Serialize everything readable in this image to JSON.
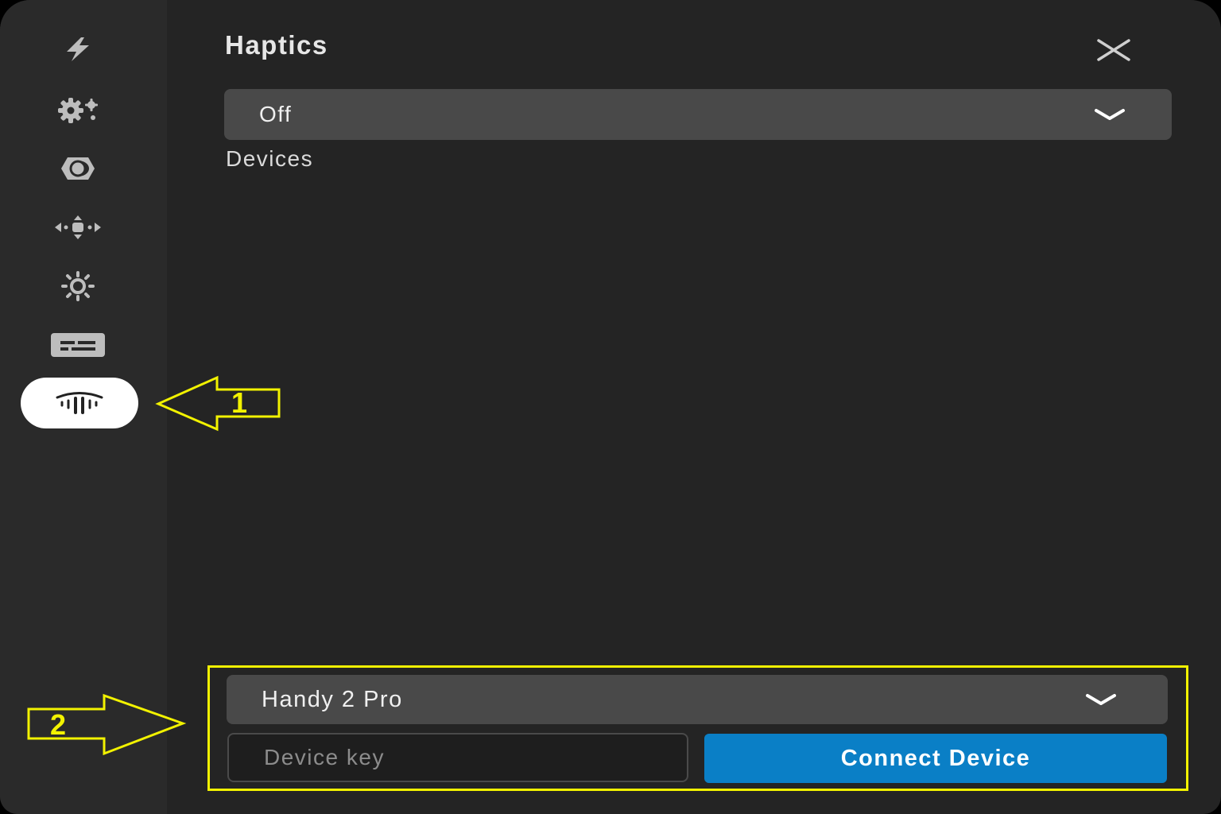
{
  "panel": {
    "title": "Haptics",
    "mode_select_value": "Off",
    "devices_label": "Devices"
  },
  "sidebar": {
    "items": [
      {
        "icon": "bolt-icon"
      },
      {
        "icon": "gears-icon"
      },
      {
        "icon": "contrast-icon"
      },
      {
        "icon": "move-icon"
      },
      {
        "icon": "brightness-icon"
      },
      {
        "icon": "subtitles-icon"
      },
      {
        "icon": "haptics-icon",
        "active": true
      }
    ]
  },
  "device": {
    "select_value": "Handy 2 Pro",
    "key_placeholder": "Device key",
    "connect_label": "Connect Device"
  },
  "annotations": {
    "arrow1_label": "1",
    "arrow2_label": "2",
    "color": "#f2f200"
  },
  "colors": {
    "background": "#242424",
    "sidebar": "#2a2a2a",
    "select": "#494949",
    "accent": "#0a7fc6"
  }
}
